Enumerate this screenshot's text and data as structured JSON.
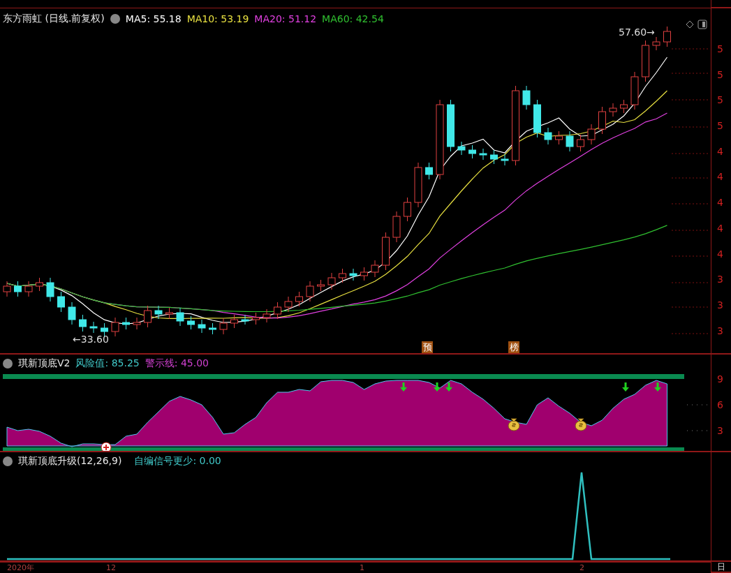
{
  "main_panel": {
    "title": "东方雨虹 (日线.前复权)",
    "moving_averages": [
      {
        "label": "MA5: 55.18",
        "color": "#ffffff"
      },
      {
        "label": "MA10: 53.19",
        "color": "#e8e040"
      },
      {
        "label": "MA20: 51.12",
        "color": "#e040e0"
      },
      {
        "label": "MA60: 42.54",
        "color": "#30c030"
      }
    ],
    "high_label": "57.60→",
    "low_label": "←33.60",
    "markers": [
      "预",
      "榜"
    ],
    "axis_ticks": [
      "5",
      "5",
      "5",
      "5",
      "4",
      "4",
      "4",
      "4",
      "4",
      "3",
      "3",
      "3"
    ]
  },
  "indicator_panel": {
    "title": "琪新顶底V2",
    "values": [
      {
        "text": "风险值: 85.25",
        "color": "#40c8c8"
      },
      {
        "text": "警示线: 45.00",
        "color": "#d040d0"
      }
    ],
    "axis_ticks": [
      "9",
      "6",
      "3"
    ]
  },
  "signal_panel": {
    "title": "琪新顶底升级(12,26,9)",
    "value": "自编信号更少: 0.00"
  },
  "time_axis": {
    "labels": [
      "2020年",
      "12",
      "1",
      "2"
    ],
    "corner": "日"
  }
}
